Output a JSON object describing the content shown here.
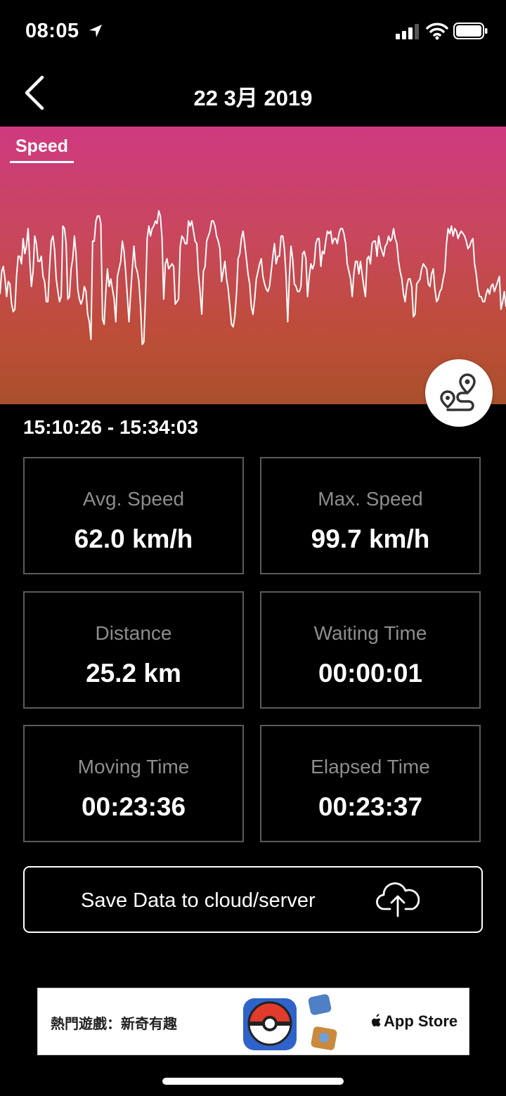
{
  "status_bar": {
    "time": "08:05",
    "icons": [
      "location-arrow-icon",
      "signal-icon",
      "wifi-icon",
      "battery-icon"
    ]
  },
  "nav": {
    "title": "22 3月 2019",
    "back_icon": "chevron-left-icon"
  },
  "chart_data": {
    "type": "line",
    "title": "",
    "tab_label": "Speed",
    "xlabel": "",
    "ylabel": "",
    "grid": false,
    "series": [
      {
        "name": "Speed",
        "values": [
          49,
          58,
          60,
          55,
          48,
          54,
          53,
          45,
          42,
          43,
          56,
          64,
          64,
          61,
          71,
          65,
          68,
          75,
          62,
          52,
          58,
          72,
          69,
          62,
          62,
          64,
          56,
          54,
          46,
          46,
          60,
          70,
          72,
          67,
          55,
          50,
          46,
          48,
          76,
          75,
          69,
          47,
          48,
          59,
          63,
          72,
          65,
          51,
          47,
          45,
          47,
          52,
          50,
          41,
          38,
          31,
          70,
          70,
          78,
          80,
          80,
          77,
          39,
          37,
          50,
          59,
          52,
          55,
          51,
          47,
          38,
          56,
          59,
          62,
          70,
          66,
          58,
          48,
          38,
          49,
          59,
          68,
          60,
          58,
          54,
          44,
          29,
          30,
          48,
          71,
          76,
          72,
          75,
          76,
          78,
          77,
          82,
          80,
          71,
          47,
          61,
          63,
          59,
          60,
          61,
          60,
          45,
          46,
          47,
          68,
          72,
          71,
          69,
          69,
          78,
          76,
          78,
          74,
          70,
          69,
          57,
          50,
          41,
          58,
          60,
          70,
          72,
          74,
          78,
          78,
          76,
          72,
          70,
          67,
          54,
          58,
          62,
          55,
          51,
          44,
          37,
          36,
          40,
          49,
          63,
          65,
          71,
          74,
          69,
          63,
          57,
          53,
          44,
          41,
          47,
          55,
          58,
          61,
          63,
          56,
          53,
          51,
          50,
          52,
          58,
          64,
          69,
          61,
          64,
          64,
          72,
          72,
          67,
          56,
          38,
          56,
          68,
          63,
          53,
          52,
          50,
          50,
          52,
          65,
          66,
          63,
          48,
          56,
          61,
          59,
          61,
          69,
          71,
          71,
          60,
          66,
          65,
          70,
          74,
          73,
          74,
          69,
          71,
          71,
          69,
          73,
          75,
          75,
          73,
          69,
          61,
          58,
          55,
          48,
          57,
          62,
          62,
          57,
          62,
          57,
          52,
          48,
          63,
          64,
          61,
          69,
          70,
          70,
          64,
          72,
          68,
          66,
          64,
          68,
          69,
          72,
          70,
          71,
          75,
          71,
          69,
          62,
          58,
          55,
          49,
          46,
          52,
          55,
          55,
          52,
          40,
          41,
          53,
          54,
          55,
          59,
          61,
          60,
          59,
          53,
          52,
          57,
          59,
          51,
          46,
          47,
          50,
          51,
          55,
          58,
          69,
          75,
          73,
          76,
          72,
          75,
          74,
          71,
          73,
          74,
          73,
          72,
          70,
          67,
          68,
          70,
          71,
          61,
          57,
          51,
          48,
          48,
          46,
          46,
          49,
          51,
          49,
          52,
          53,
          50,
          52,
          54,
          56,
          43,
          46,
          50,
          44
        ]
      }
    ]
  },
  "route_button_icon": "route-map-icon",
  "time_range": "15:10:26 - 15:34:03",
  "stats": [
    {
      "label": "Avg. Speed",
      "value": "62.0 km/h"
    },
    {
      "label": "Max. Speed",
      "value": "99.7 km/h"
    },
    {
      "label": "Distance",
      "value": "25.2 km"
    },
    {
      "label": "Waiting Time",
      "value": "00:00:01"
    },
    {
      "label": "Moving Time",
      "value": "00:23:36"
    },
    {
      "label": "Elapsed Time",
      "value": "00:23:37"
    }
  ],
  "save_button": {
    "label": "Save Data to cloud/server",
    "icon": "cloud-upload-icon"
  },
  "ad": {
    "text": "熱門遊戲：新奇有趣",
    "store": "App Store",
    "icons": [
      "pokeball-icon",
      "game-tiles-icon",
      "apple-logo-icon"
    ]
  },
  "colors": {
    "background": "#000000",
    "chart_top": "#cf3a80",
    "chart_bottom": "#a9502b",
    "card_border": "#5b5b5b",
    "label_gray": "#8d8d8d"
  }
}
